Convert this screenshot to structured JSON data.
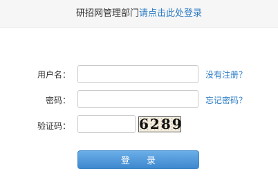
{
  "header": {
    "title": "研招网管理部门",
    "login_link": "请点击此处登录"
  },
  "form": {
    "username_label": "用户名：",
    "username_value": "",
    "no_account_link": "没有注册？",
    "password_label": "密码：",
    "password_value": "",
    "forgot_password_link": "忘记密码？",
    "captcha_label": "验证码：",
    "captcha_value": "",
    "captcha_text": "6289",
    "login_button": "登 录"
  },
  "colors": {
    "link": "#2b7bc4",
    "button": "#4a92d6"
  }
}
